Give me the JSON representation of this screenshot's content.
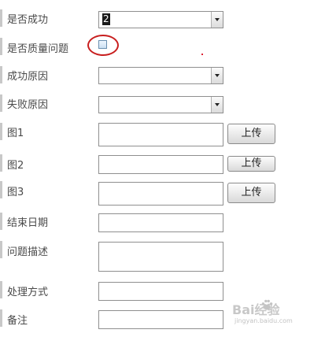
{
  "form": {
    "success": {
      "label": "是否成功",
      "value": "2"
    },
    "quality_issue": {
      "label": "是否质量问题",
      "checked": false
    },
    "success_reason": {
      "label": "成功原因",
      "value": ""
    },
    "fail_reason": {
      "label": "失败原因",
      "value": ""
    },
    "image1": {
      "label": "图1",
      "button": "上传"
    },
    "image2": {
      "label": "图2",
      "button": "上传"
    },
    "image3": {
      "label": "图3",
      "button": "上传"
    },
    "end_date": {
      "label": "结束日期",
      "value": ""
    },
    "description": {
      "label": "问题描述",
      "value": ""
    },
    "handling": {
      "label": "处理方式",
      "value": ""
    },
    "remarks": {
      "label": "备注",
      "value": ""
    }
  },
  "annotation": {
    "circle_color": "#c81e1e"
  },
  "watermark": {
    "logo": "Bai经验",
    "url": "jingyan.baidu.com"
  }
}
